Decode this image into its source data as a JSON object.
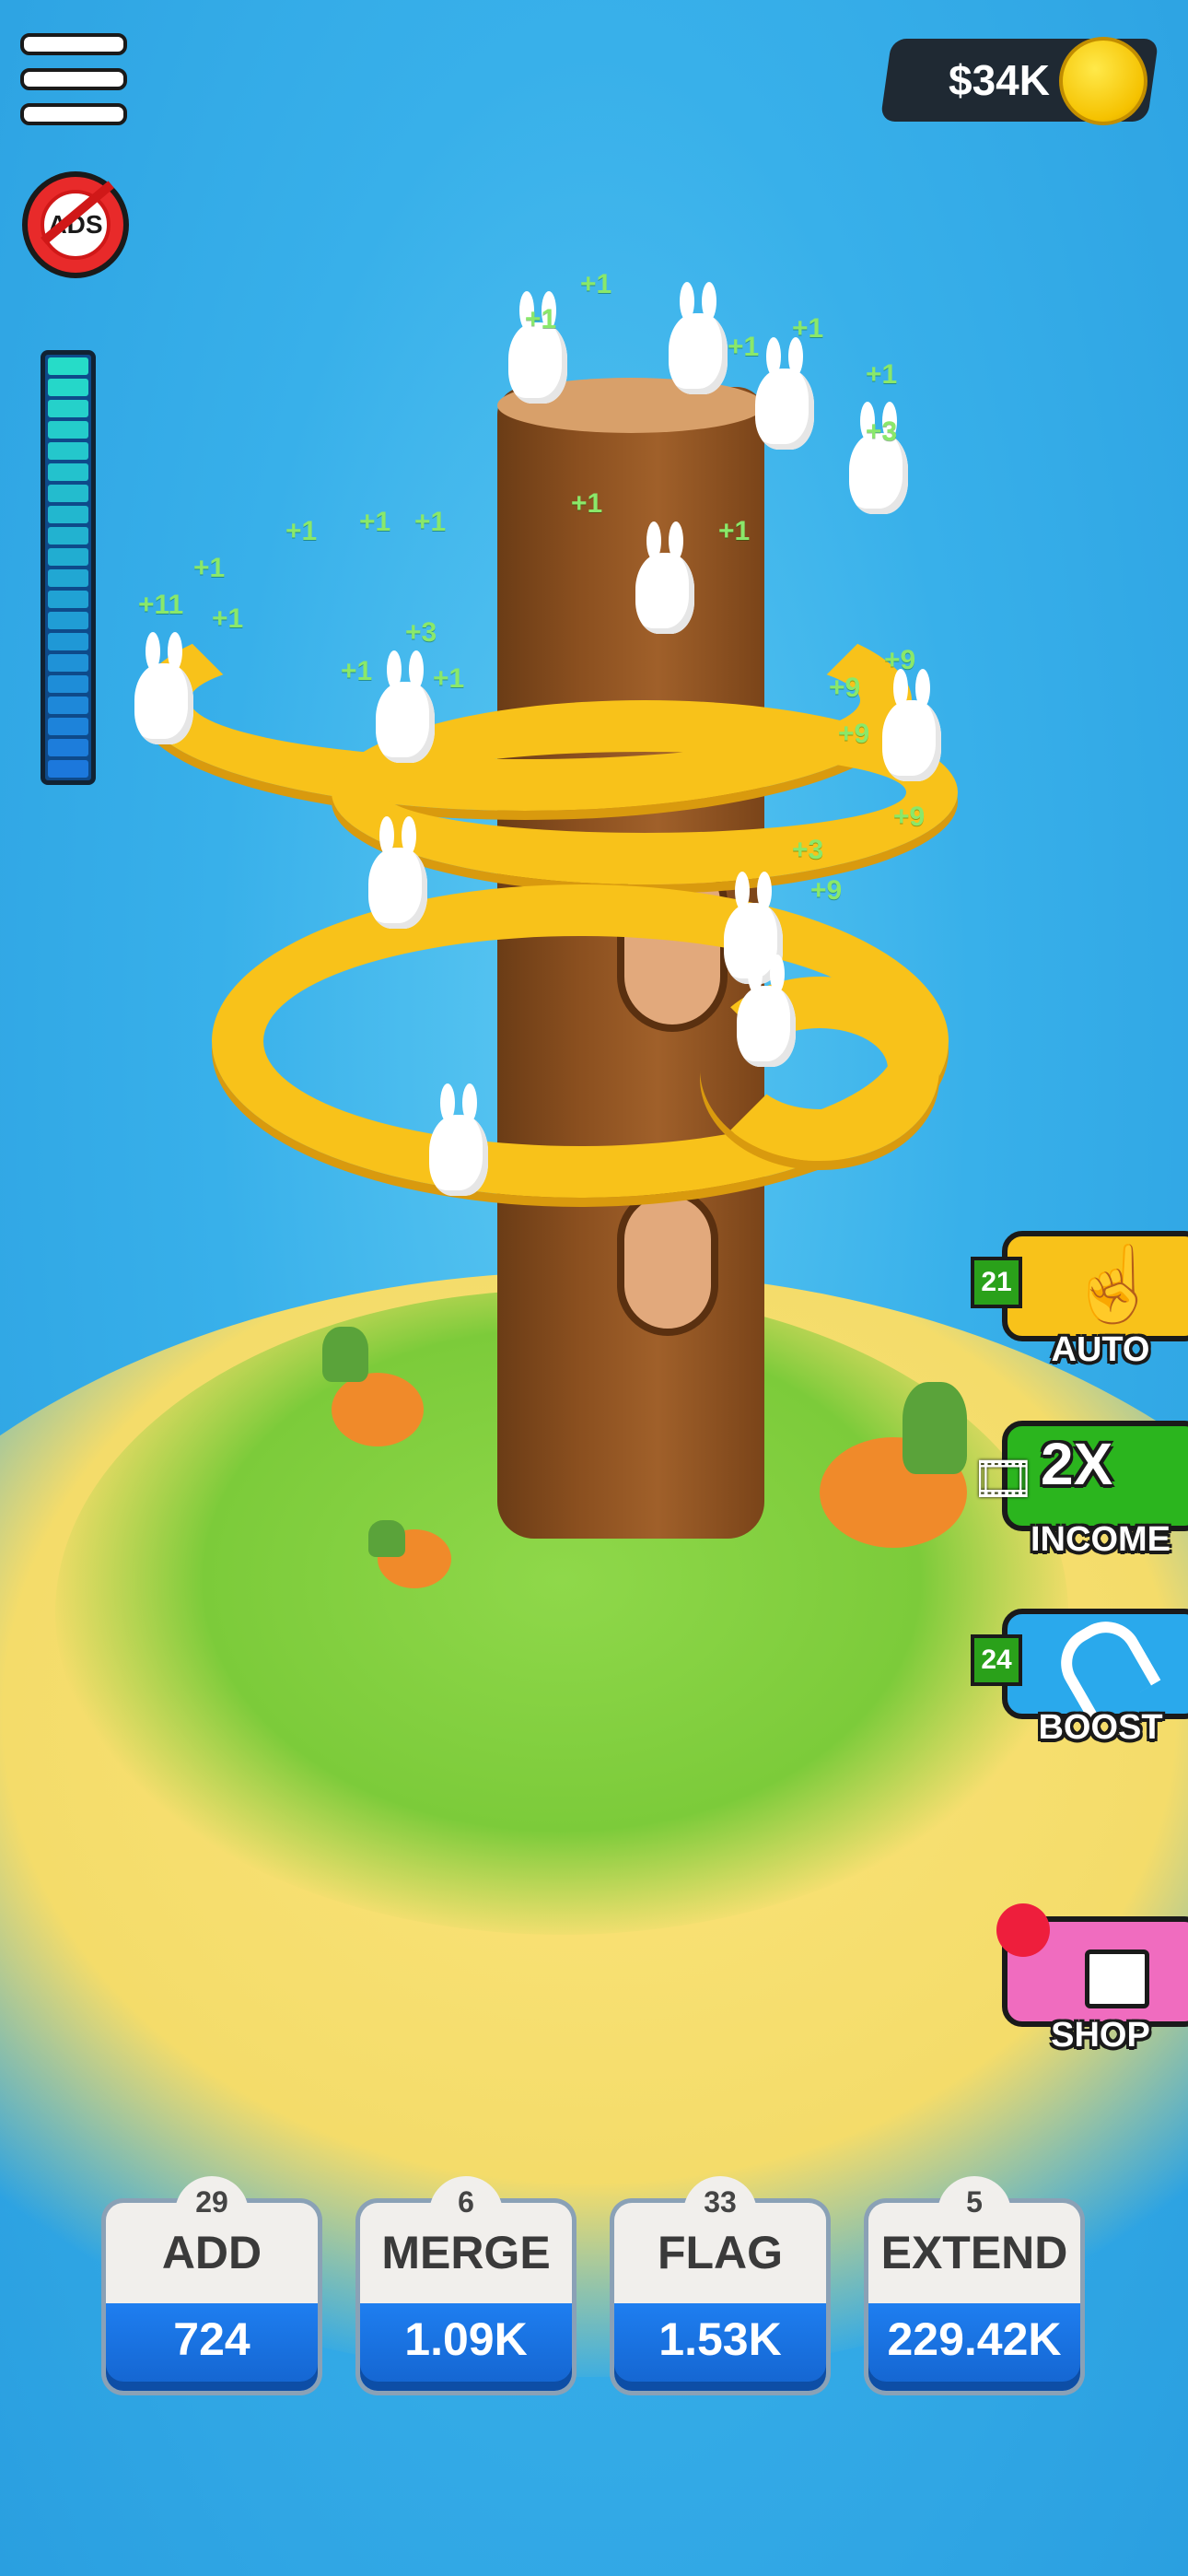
{
  "hud": {
    "money": "$34K",
    "ads_label": "ADS"
  },
  "progress": {
    "segments": 20,
    "filled_fraction": 1.0
  },
  "side_buttons": {
    "auto": {
      "label": "AUTO",
      "count": "21",
      "color": "#f8c21a"
    },
    "income": {
      "label": "INCOME",
      "multiplier": "2X",
      "color": "#2bb51e"
    },
    "boost": {
      "label": "BOOST",
      "count": "24",
      "color": "#2aa9ec"
    },
    "shop": {
      "label": "SHOP",
      "color": "#f06cbf"
    }
  },
  "floating_texts": [
    "+1",
    "+1",
    "+1",
    "+1",
    "+1",
    "+3",
    "+1",
    "+1",
    "+1",
    "+1",
    "+1",
    "+11",
    "+1",
    "+3",
    "+1",
    "+1",
    "+9",
    "+9",
    "+9",
    "+9",
    "+3",
    "+9",
    "+1"
  ],
  "upgrades": [
    {
      "level": "29",
      "title": "ADD",
      "price": "724"
    },
    {
      "level": "6",
      "title": "MERGE",
      "price": "1.09K"
    },
    {
      "level": "33",
      "title": "FLAG",
      "price": "1.53K"
    },
    {
      "level": "5",
      "title": "EXTEND",
      "price": "229.42K"
    }
  ]
}
